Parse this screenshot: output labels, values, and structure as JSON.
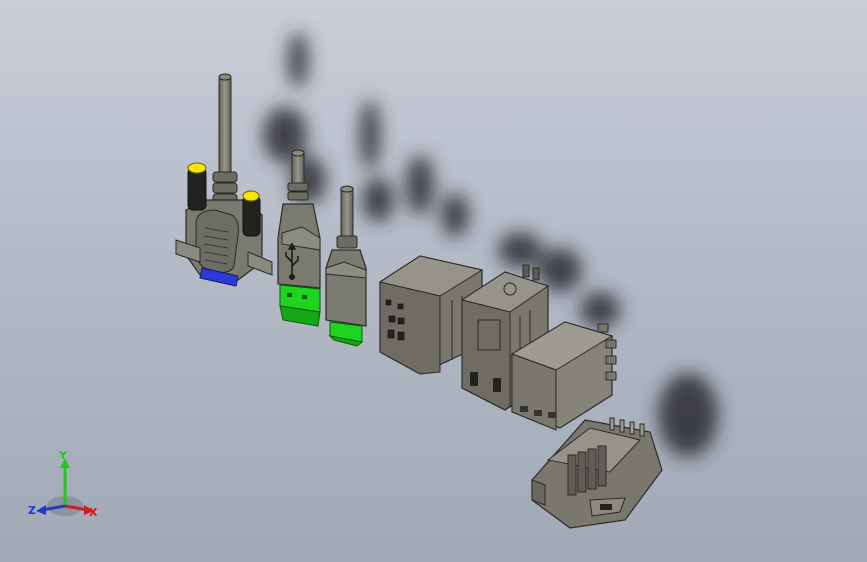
{
  "viewport": {
    "background_top": "#c9ced8",
    "background_bottom": "#a1a9b6"
  },
  "models": [
    {
      "name": "db9-connector-with-cable",
      "body_color": "#7b7a70",
      "accent_color": "#f2e600",
      "contact_color": "#2b3ad8"
    },
    {
      "name": "usb-type-a-plug-large",
      "body_color": "#7b7a70",
      "accent_color": "#1fd41f"
    },
    {
      "name": "usb-type-a-plug-small",
      "body_color": "#7b7a70",
      "accent_color": "#1fd41f"
    },
    {
      "name": "rj45-jack-block",
      "body_color": "#7a786e"
    },
    {
      "name": "rj45-jack-vertical",
      "body_color": "#7a786e"
    },
    {
      "name": "relay-module",
      "body_color": "#86847a"
    },
    {
      "name": "rj11-pcb-jack",
      "body_color": "#7a786e"
    }
  ],
  "triad": {
    "y_label": "Y",
    "z_label": "Z",
    "x_label": "X",
    "y_color": "#22c81e",
    "z_color": "#1e3cc8",
    "x_color": "#d21e1e"
  }
}
